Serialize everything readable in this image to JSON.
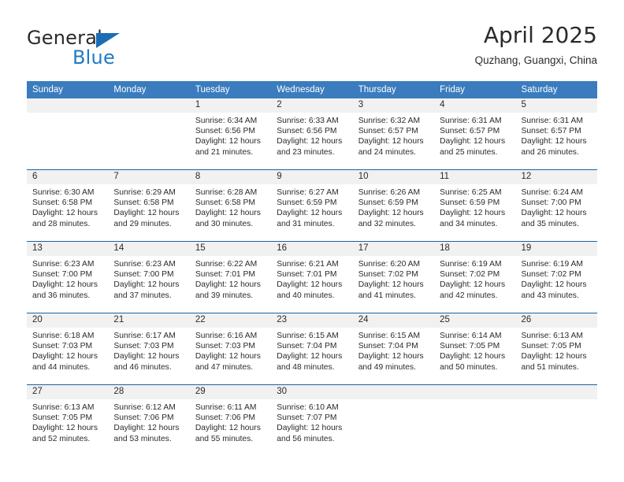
{
  "brand": {
    "logo_primary": "General",
    "logo_secondary": "Blue",
    "triangle_icon": "blue-triangle-icon"
  },
  "header": {
    "title": "April 2025",
    "subtitle": "Quzhang, Guangxi, China"
  },
  "colors": {
    "header_blue": "#3a7cbe",
    "separator_blue": "#1f5fa0",
    "logo_blue": "#1f7bc4",
    "daynum_band": "#f1f1f1",
    "text": "#2b2b2b"
  },
  "weekdays": [
    "Sunday",
    "Monday",
    "Tuesday",
    "Wednesday",
    "Thursday",
    "Friday",
    "Saturday"
  ],
  "weeks": [
    [
      {
        "day": "",
        "empty": true
      },
      {
        "day": "",
        "empty": true
      },
      {
        "day": "1",
        "sunrise": "Sunrise: 6:34 AM",
        "sunset": "Sunset: 6:56 PM",
        "daylight1": "Daylight: 12 hours",
        "daylight2": "and 21 minutes."
      },
      {
        "day": "2",
        "sunrise": "Sunrise: 6:33 AM",
        "sunset": "Sunset: 6:56 PM",
        "daylight1": "Daylight: 12 hours",
        "daylight2": "and 23 minutes."
      },
      {
        "day": "3",
        "sunrise": "Sunrise: 6:32 AM",
        "sunset": "Sunset: 6:57 PM",
        "daylight1": "Daylight: 12 hours",
        "daylight2": "and 24 minutes."
      },
      {
        "day": "4",
        "sunrise": "Sunrise: 6:31 AM",
        "sunset": "Sunset: 6:57 PM",
        "daylight1": "Daylight: 12 hours",
        "daylight2": "and 25 minutes."
      },
      {
        "day": "5",
        "sunrise": "Sunrise: 6:31 AM",
        "sunset": "Sunset: 6:57 PM",
        "daylight1": "Daylight: 12 hours",
        "daylight2": "and 26 minutes."
      }
    ],
    [
      {
        "day": "6",
        "sunrise": "Sunrise: 6:30 AM",
        "sunset": "Sunset: 6:58 PM",
        "daylight1": "Daylight: 12 hours",
        "daylight2": "and 28 minutes."
      },
      {
        "day": "7",
        "sunrise": "Sunrise: 6:29 AM",
        "sunset": "Sunset: 6:58 PM",
        "daylight1": "Daylight: 12 hours",
        "daylight2": "and 29 minutes."
      },
      {
        "day": "8",
        "sunrise": "Sunrise: 6:28 AM",
        "sunset": "Sunset: 6:58 PM",
        "daylight1": "Daylight: 12 hours",
        "daylight2": "and 30 minutes."
      },
      {
        "day": "9",
        "sunrise": "Sunrise: 6:27 AM",
        "sunset": "Sunset: 6:59 PM",
        "daylight1": "Daylight: 12 hours",
        "daylight2": "and 31 minutes."
      },
      {
        "day": "10",
        "sunrise": "Sunrise: 6:26 AM",
        "sunset": "Sunset: 6:59 PM",
        "daylight1": "Daylight: 12 hours",
        "daylight2": "and 32 minutes."
      },
      {
        "day": "11",
        "sunrise": "Sunrise: 6:25 AM",
        "sunset": "Sunset: 6:59 PM",
        "daylight1": "Daylight: 12 hours",
        "daylight2": "and 34 minutes."
      },
      {
        "day": "12",
        "sunrise": "Sunrise: 6:24 AM",
        "sunset": "Sunset: 7:00 PM",
        "daylight1": "Daylight: 12 hours",
        "daylight2": "and 35 minutes."
      }
    ],
    [
      {
        "day": "13",
        "sunrise": "Sunrise: 6:23 AM",
        "sunset": "Sunset: 7:00 PM",
        "daylight1": "Daylight: 12 hours",
        "daylight2": "and 36 minutes."
      },
      {
        "day": "14",
        "sunrise": "Sunrise: 6:23 AM",
        "sunset": "Sunset: 7:00 PM",
        "daylight1": "Daylight: 12 hours",
        "daylight2": "and 37 minutes."
      },
      {
        "day": "15",
        "sunrise": "Sunrise: 6:22 AM",
        "sunset": "Sunset: 7:01 PM",
        "daylight1": "Daylight: 12 hours",
        "daylight2": "and 39 minutes."
      },
      {
        "day": "16",
        "sunrise": "Sunrise: 6:21 AM",
        "sunset": "Sunset: 7:01 PM",
        "daylight1": "Daylight: 12 hours",
        "daylight2": "and 40 minutes."
      },
      {
        "day": "17",
        "sunrise": "Sunrise: 6:20 AM",
        "sunset": "Sunset: 7:02 PM",
        "daylight1": "Daylight: 12 hours",
        "daylight2": "and 41 minutes."
      },
      {
        "day": "18",
        "sunrise": "Sunrise: 6:19 AM",
        "sunset": "Sunset: 7:02 PM",
        "daylight1": "Daylight: 12 hours",
        "daylight2": "and 42 minutes."
      },
      {
        "day": "19",
        "sunrise": "Sunrise: 6:19 AM",
        "sunset": "Sunset: 7:02 PM",
        "daylight1": "Daylight: 12 hours",
        "daylight2": "and 43 minutes."
      }
    ],
    [
      {
        "day": "20",
        "sunrise": "Sunrise: 6:18 AM",
        "sunset": "Sunset: 7:03 PM",
        "daylight1": "Daylight: 12 hours",
        "daylight2": "and 44 minutes."
      },
      {
        "day": "21",
        "sunrise": "Sunrise: 6:17 AM",
        "sunset": "Sunset: 7:03 PM",
        "daylight1": "Daylight: 12 hours",
        "daylight2": "and 46 minutes."
      },
      {
        "day": "22",
        "sunrise": "Sunrise: 6:16 AM",
        "sunset": "Sunset: 7:03 PM",
        "daylight1": "Daylight: 12 hours",
        "daylight2": "and 47 minutes."
      },
      {
        "day": "23",
        "sunrise": "Sunrise: 6:15 AM",
        "sunset": "Sunset: 7:04 PM",
        "daylight1": "Daylight: 12 hours",
        "daylight2": "and 48 minutes."
      },
      {
        "day": "24",
        "sunrise": "Sunrise: 6:15 AM",
        "sunset": "Sunset: 7:04 PM",
        "daylight1": "Daylight: 12 hours",
        "daylight2": "and 49 minutes."
      },
      {
        "day": "25",
        "sunrise": "Sunrise: 6:14 AM",
        "sunset": "Sunset: 7:05 PM",
        "daylight1": "Daylight: 12 hours",
        "daylight2": "and 50 minutes."
      },
      {
        "day": "26",
        "sunrise": "Sunrise: 6:13 AM",
        "sunset": "Sunset: 7:05 PM",
        "daylight1": "Daylight: 12 hours",
        "daylight2": "and 51 minutes."
      }
    ],
    [
      {
        "day": "27",
        "sunrise": "Sunrise: 6:13 AM",
        "sunset": "Sunset: 7:05 PM",
        "daylight1": "Daylight: 12 hours",
        "daylight2": "and 52 minutes."
      },
      {
        "day": "28",
        "sunrise": "Sunrise: 6:12 AM",
        "sunset": "Sunset: 7:06 PM",
        "daylight1": "Daylight: 12 hours",
        "daylight2": "and 53 minutes."
      },
      {
        "day": "29",
        "sunrise": "Sunrise: 6:11 AM",
        "sunset": "Sunset: 7:06 PM",
        "daylight1": "Daylight: 12 hours",
        "daylight2": "and 55 minutes."
      },
      {
        "day": "30",
        "sunrise": "Sunrise: 6:10 AM",
        "sunset": "Sunset: 7:07 PM",
        "daylight1": "Daylight: 12 hours",
        "daylight2": "and 56 minutes."
      },
      {
        "day": "",
        "empty": true
      },
      {
        "day": "",
        "empty": true
      },
      {
        "day": "",
        "empty": true
      }
    ]
  ]
}
